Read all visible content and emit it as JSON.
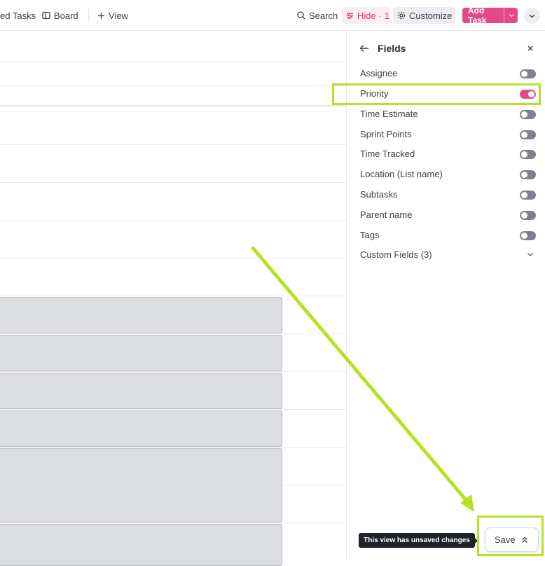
{
  "toolbar": {
    "tab_assigned_tasks": "ed Tasks",
    "tab_board": "Board",
    "add_view": "View",
    "search": "Search",
    "hide_label": "Hide",
    "hide_count": "· 1",
    "customize": "Customize",
    "add_task": "Add Task"
  },
  "panel": {
    "title": "Fields",
    "fields": [
      {
        "label": "Assignee",
        "on": false
      },
      {
        "label": "Priority",
        "on": true
      },
      {
        "label": "Time Estimate",
        "on": false
      },
      {
        "label": "Sprint Points",
        "on": false
      },
      {
        "label": "Time Tracked",
        "on": false
      },
      {
        "label": "Location (List name)",
        "on": false
      },
      {
        "label": "Subtasks",
        "on": false
      },
      {
        "label": "Parent name",
        "on": false
      },
      {
        "label": "Tags",
        "on": false
      }
    ],
    "custom_fields": "Custom Fields (3)"
  },
  "footer": {
    "tooltip": "This view has unsaved changes",
    "save": "Save"
  },
  "colors": {
    "accent": "#e44a8a",
    "highlight": "#b4e224",
    "toggle_off": "#7c828d"
  }
}
